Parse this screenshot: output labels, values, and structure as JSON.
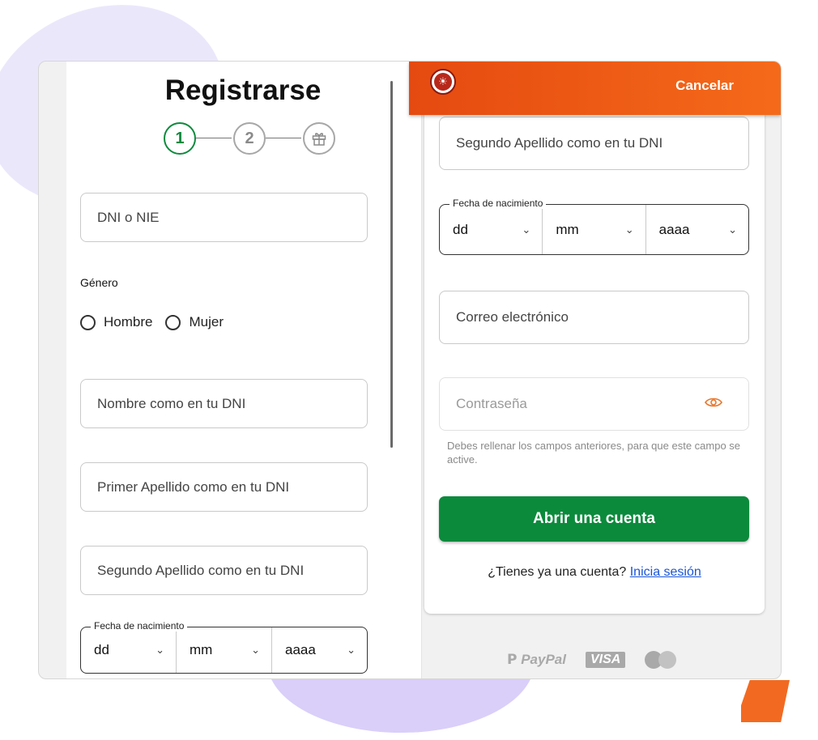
{
  "left": {
    "title": "Registrarse",
    "steps": [
      "1",
      "2"
    ],
    "dni_placeholder": "DNI o NIE",
    "gender_label": "Género",
    "gender_options": [
      "Hombre",
      "Mujer"
    ],
    "name_placeholder": "Nombre como en tu DNI",
    "first_surname_placeholder": "Primer Apellido como en tu DNI",
    "second_surname_placeholder": "Segundo Apellido como en tu DNI",
    "dob": {
      "legend": "Fecha de nacimiento",
      "day": "dd",
      "month": "mm",
      "year": "aaaa"
    }
  },
  "right": {
    "header": {
      "cancel_label": "Cancelar",
      "logo": "lion-logo"
    },
    "second_surname_placeholder": "Segundo Apellido como en tu DNI",
    "dob": {
      "legend": "Fecha de nacimiento",
      "day": "dd",
      "month": "mm",
      "year": "aaaa"
    },
    "email_placeholder": "Correo electrónico",
    "password_placeholder": "Contraseña",
    "password_hint": "Debes rellenar los campos anteriores, para que este campo se active.",
    "submit_label": "Abrir una cuenta",
    "login_prompt": "¿Tienes ya una cuenta?",
    "login_link": "Inicia sesión",
    "payment_methods": [
      "PayPal",
      "VISA"
    ]
  },
  "colors": {
    "brand_orange": "#f05a16",
    "primary_green": "#0b8a3c",
    "link_blue": "#1a55d6"
  }
}
